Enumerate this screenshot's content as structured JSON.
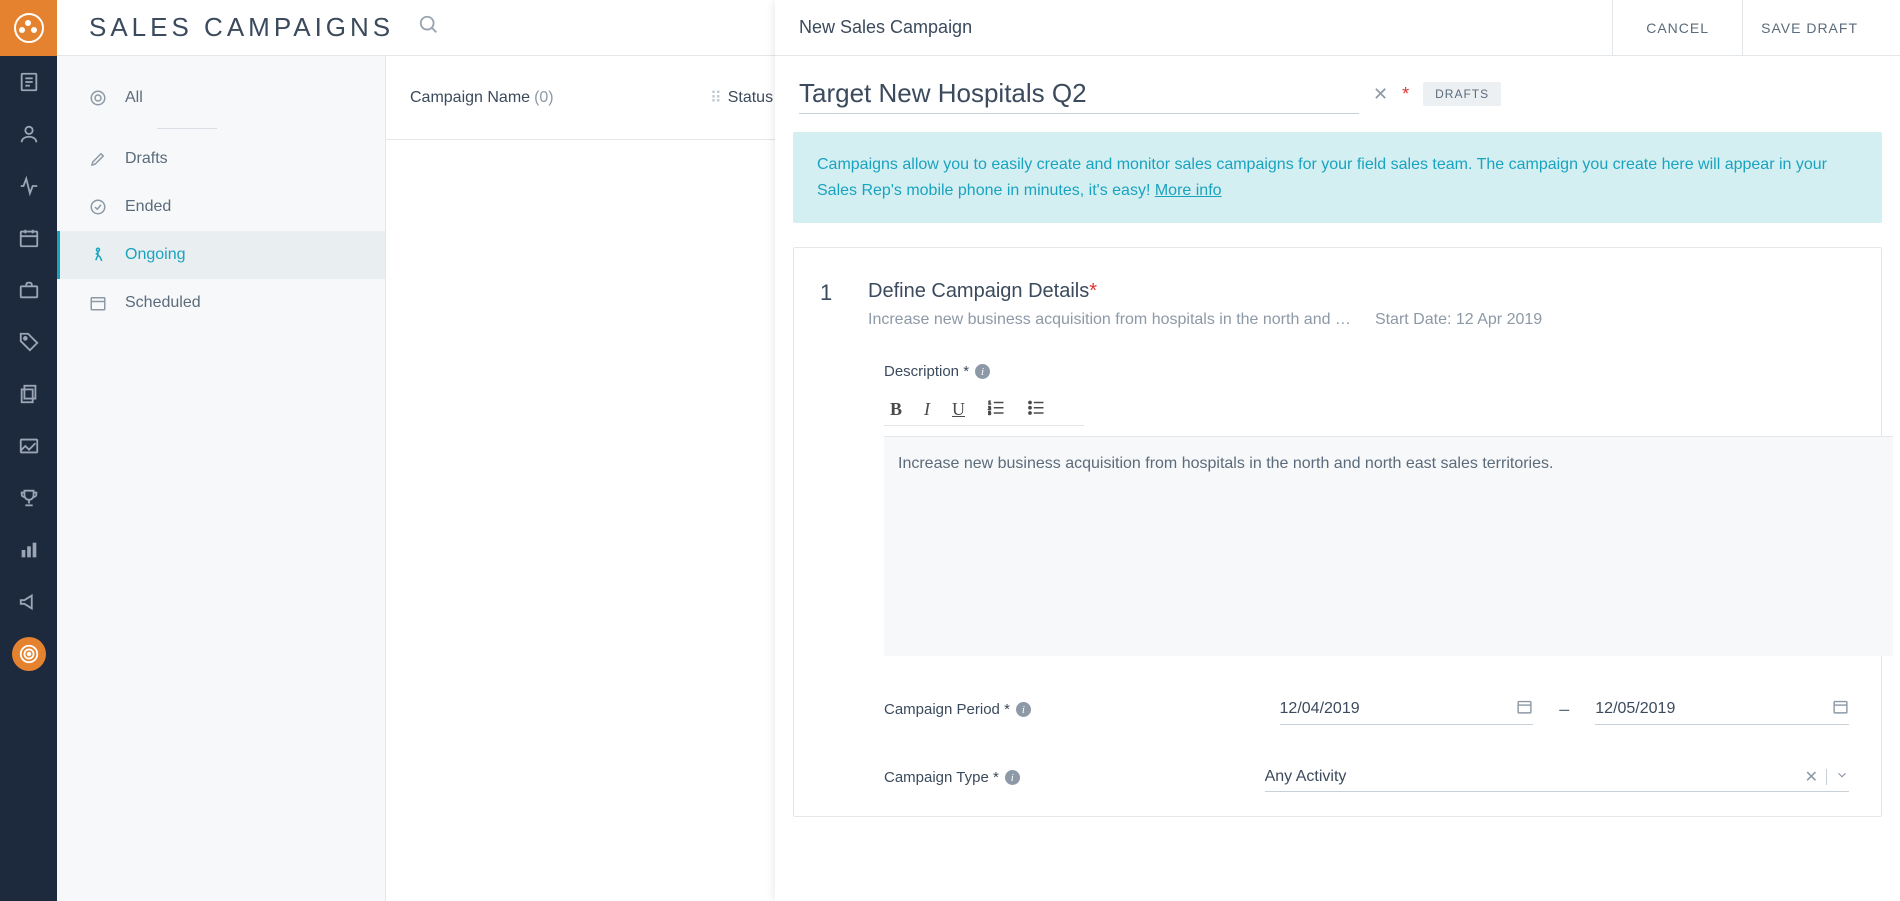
{
  "header": {
    "title": "SALES CAMPAIGNS"
  },
  "filters": {
    "all": "All",
    "drafts": "Drafts",
    "ended": "Ended",
    "ongoing": "Ongoing",
    "scheduled": "Scheduled"
  },
  "list": {
    "col_campaign_name": "Campaign Name",
    "col_campaign_count": "(0)",
    "col_status": "Status"
  },
  "panel": {
    "title": "New Sales Campaign",
    "cancel": "CANCEL",
    "save_draft": "SAVE DRAFT",
    "campaign_name_value": "Target New Hospitals Q2",
    "draft_badge": "DRAFTS",
    "banner_text": "Campaigns allow you to easily create and monitor sales campaigns for your field sales team. The campaign you create here will appear in your Sales Rep's mobile phone in minutes, it's easy! ",
    "banner_more": "More info",
    "step1": {
      "num": "1",
      "title": "Define Campaign Details",
      "sub_desc": "Increase new business acquisition from hospitals in the north and …",
      "sub_start": "Start Date: 12 Apr 2019",
      "description_label": "Description *",
      "description_value": "Increase new business acquisition from hospitals in the north and north east sales territories.",
      "period_label": "Campaign Period *",
      "date_from": "12/04/2019",
      "date_to": "12/05/2019",
      "type_label": "Campaign Type *",
      "type_value": "Any Activity"
    }
  }
}
